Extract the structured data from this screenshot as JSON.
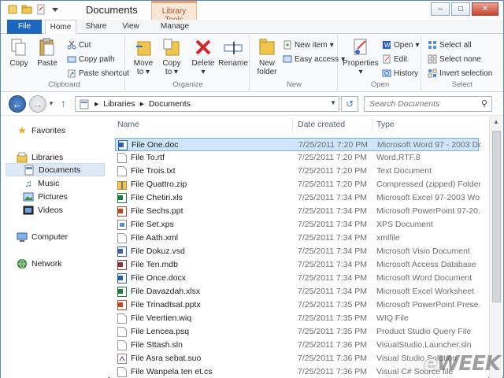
{
  "window": {
    "title": "Documents",
    "context_tab_title": "Library Tools"
  },
  "tabs": [
    {
      "label": "File"
    },
    {
      "label": "Home"
    },
    {
      "label": "Share"
    },
    {
      "label": "View"
    },
    {
      "label": "Manage"
    }
  ],
  "ribbon": {
    "clipboard": {
      "group": "Clipboard",
      "copy": "Copy",
      "paste": "Paste",
      "cut": "Cut",
      "copy_path": "Copy path",
      "paste_shortcut": "Paste shortcut"
    },
    "organize": {
      "group": "Organize",
      "move_to": "Move",
      "move_to2": "to",
      "copy_to": "Copy",
      "copy_to2": "to",
      "delete": "Delete",
      "rename": "Rename"
    },
    "new": {
      "group": "New",
      "new_folder": "New",
      "new_folder2": "folder",
      "new_item": "New item",
      "easy_access": "Easy access"
    },
    "open": {
      "group": "Open",
      "properties": "Properties",
      "open": "Open",
      "edit": "Edit",
      "history": "History"
    },
    "select": {
      "group": "Select",
      "select_all": "Select all",
      "select_none": "Select none",
      "invert": "Invert selection"
    }
  },
  "address": {
    "crumb1": "Libraries",
    "crumb2": "Documents",
    "sep": "▸"
  },
  "search": {
    "placeholder": "Search Documents"
  },
  "navpane": {
    "favorites": "Favorites",
    "libraries": "Libraries",
    "documents": "Documents",
    "music": "Music",
    "pictures": "Pictures",
    "videos": "Videos",
    "computer": "Computer",
    "network": "Network"
  },
  "columns": {
    "name": "Name",
    "date": "Date created",
    "type": "Type"
  },
  "files": [
    {
      "name": "File One.doc",
      "date": "7/25/2011 7:20 PM",
      "type": "Microsoft Word 97 - 2003 Do...",
      "icon": "word-icon"
    },
    {
      "name": "File To.rtf",
      "date": "7/25/2011 7:20 PM",
      "type": "Word.RTF.8",
      "icon": "doc-icon"
    },
    {
      "name": "File Trois.txt",
      "date": "7/25/2011 7:20 PM",
      "type": "Text Document",
      "icon": "doc-icon"
    },
    {
      "name": "File Quattro.zip",
      "date": "7/25/2011 7:20 PM",
      "type": "Compressed (zipped) Folder",
      "icon": "zip-icon"
    },
    {
      "name": "File Chetiri.xls",
      "date": "7/25/2011 7:34 PM",
      "type": "Microsoft Excel 97-2003 Wor...",
      "icon": "excel-icon"
    },
    {
      "name": "File Sechs.ppt",
      "date": "7/25/2011 7:34 PM",
      "type": "Microsoft PowerPoint 97-20...",
      "icon": "ppt-icon"
    },
    {
      "name": "File Set.xps",
      "date": "7/25/2011 7:34 PM",
      "type": "XPS Document",
      "icon": "xps-icon"
    },
    {
      "name": "File Aath.xml",
      "date": "7/25/2011 7:34 PM",
      "type": "xmlfile",
      "icon": "doc-icon"
    },
    {
      "name": "File Dokuz.vsd",
      "date": "7/25/2011 7:34 PM",
      "type": "Microsoft Visio Document",
      "icon": "visio-icon"
    },
    {
      "name": "File Ten.mdb",
      "date": "7/25/2011 7:34 PM",
      "type": "Microsoft Access Database",
      "icon": "access-icon"
    },
    {
      "name": "File Once.docx",
      "date": "7/25/2011 7:34 PM",
      "type": "Microsoft Word Document",
      "icon": "word-icon"
    },
    {
      "name": "File Davazdah.xlsx",
      "date": "7/25/2011 7:34 PM",
      "type": "Microsoft Excel Worksheet",
      "icon": "excel-icon"
    },
    {
      "name": "File Trinadtsat.pptx",
      "date": "7/25/2011 7:35 PM",
      "type": "Microsoft PowerPoint Prese...",
      "icon": "ppt-icon"
    },
    {
      "name": "File Veertien.wiq",
      "date": "7/25/2011 7:35 PM",
      "type": "WIQ File",
      "icon": "doc-icon"
    },
    {
      "name": "File Lencea.psq",
      "date": "7/25/2011 7:35 PM",
      "type": "Product Studio Query File",
      "icon": "doc-icon"
    },
    {
      "name": "File Sttash.sln",
      "date": "7/25/2011 7:36 PM",
      "type": "VisualStudio.Launcher.sln",
      "icon": "doc-icon"
    },
    {
      "name": "File Asra sebat.suo",
      "date": "7/25/2011 7:36 PM",
      "type": "Visual Studio Solution",
      "icon": "vs-icon"
    },
    {
      "name": "File Wanpela ten et.cs",
      "date": "7/25/2011 7:36 PM",
      "type": "Visual C# Source file",
      "icon": "doc-icon"
    }
  ],
  "watermark": {
    "e": "e",
    "rest": "WEEK"
  }
}
